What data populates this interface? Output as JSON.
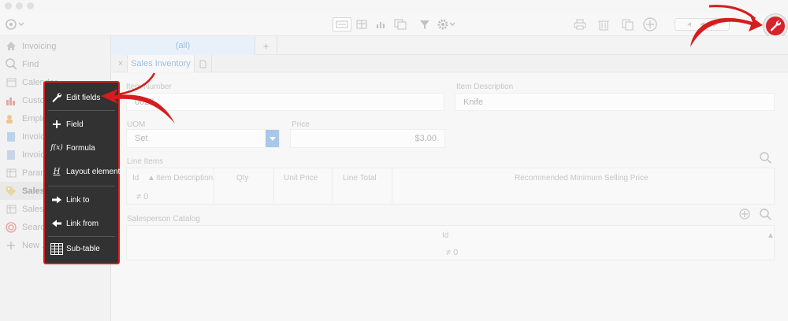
{
  "toolbar": {
    "icons": [
      "view-icon",
      "form-view-icon",
      "list-view-icon",
      "chart-view-icon",
      "table-view-icon",
      "filter-icon",
      "gear-icon",
      "print-icon",
      "trash-icon",
      "duplicate-icon",
      "add-icon",
      "prev-first-icon",
      "prev-icon",
      "next-icon",
      "wrench-icon"
    ]
  },
  "sidebar": {
    "items": [
      {
        "label": "Invoicing",
        "icon": "home-icon"
      },
      {
        "label": "Find",
        "icon": "search-icon"
      },
      {
        "label": "Calendar",
        "icon": "calendar-icon"
      },
      {
        "label": "Customers",
        "icon": "chart-icon"
      },
      {
        "label": "Employees",
        "icon": "people-icon"
      },
      {
        "label": "Invoices",
        "icon": "document-icon"
      },
      {
        "label": "Invoice...",
        "icon": "document-icon"
      },
      {
        "label": "Parameters",
        "icon": "table-icon"
      },
      {
        "label": "Sales inventory",
        "icon": "tag-icon"
      },
      {
        "label": "Salesperson",
        "icon": "table-icon"
      },
      {
        "label": "Search",
        "icon": "target-icon"
      },
      {
        "label": "New ...",
        "icon": "plus-icon"
      }
    ]
  },
  "tabs": {
    "all_label": "(all)",
    "add_label": "+",
    "view_close": "×",
    "view_tab_label": "Sales Inventory"
  },
  "form": {
    "item_number_label": "Item Number",
    "item_number_value": "0027",
    "item_description_label": "Item Description",
    "item_description_value": "Knife",
    "uom_label": "UOM",
    "uom_value": "Set",
    "price_label": "Price",
    "price_value": "$3.00",
    "line_items_label": "Line Items",
    "line_items_columns": [
      "Id",
      "Item Description",
      "Qty",
      "Unit Price",
      "Line Total",
      "Recommended Minimum Selling Price"
    ],
    "line_items_count": "0",
    "salesperson_catalog_label": "Salesperson Catalog",
    "salesperson_columns": [
      "Id"
    ],
    "salesperson_count": "0"
  },
  "menu": {
    "items": [
      {
        "label": "Edit fields",
        "icon": "wrench-icon"
      },
      {
        "label": "Field",
        "icon": "plus-icon"
      },
      {
        "label": "Formula",
        "icon": "formula-icon"
      },
      {
        "label": "Layout element",
        "icon": "layout-icon"
      },
      {
        "label": "Link to",
        "icon": "arrow-right-icon"
      },
      {
        "label": "Link from",
        "icon": "arrow-left-icon"
      },
      {
        "label": "Sub-table",
        "icon": "table-icon"
      }
    ],
    "formula_glyph": "f(x)",
    "layout_glyph": "H"
  },
  "colors": {
    "highlight_red": "#d61c1c",
    "menu_bg": "#323232",
    "accent_blue": "#9cc0e2"
  }
}
